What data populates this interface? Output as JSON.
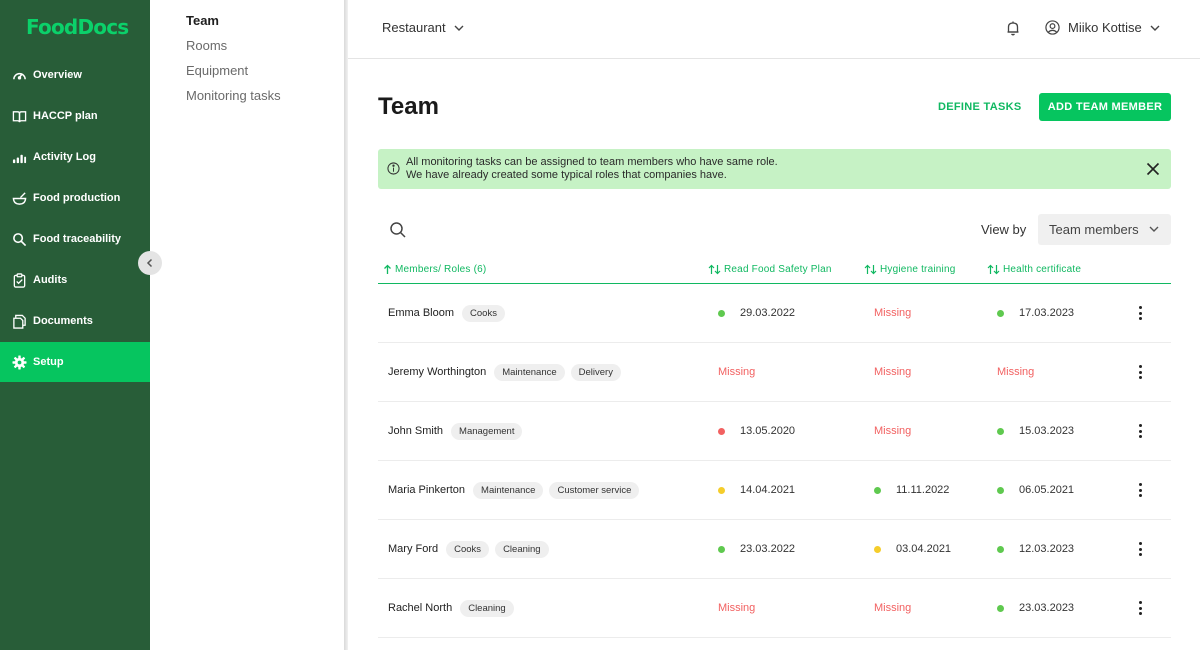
{
  "brand": {
    "logo_text": "FoodDocs"
  },
  "nav": {
    "items": [
      {
        "label": "Overview",
        "icon": "gauge-icon"
      },
      {
        "label": "HACCP plan",
        "icon": "book-icon"
      },
      {
        "label": "Activity Log",
        "icon": "bar-chart-icon"
      },
      {
        "label": "Food production",
        "icon": "bowl-icon"
      },
      {
        "label": "Food traceability",
        "icon": "search-icon"
      },
      {
        "label": "Audits",
        "icon": "clipboard-icon"
      },
      {
        "label": "Documents",
        "icon": "documents-icon"
      },
      {
        "label": "Setup",
        "icon": "gear-icon",
        "active": true
      }
    ]
  },
  "subnav": {
    "items": [
      {
        "label": "Team",
        "active": true
      },
      {
        "label": "Rooms"
      },
      {
        "label": "Equipment"
      },
      {
        "label": "Monitoring tasks"
      }
    ]
  },
  "topbar": {
    "location": "Restaurant",
    "user_name": "Miiko Kottise"
  },
  "page": {
    "title": "Team",
    "define_tasks_label": "DEFINE TASKS",
    "add_member_label": "ADD TEAM MEMBER"
  },
  "banner": {
    "line1": "All monitoring tasks can be assigned to team members who have same role.",
    "line2": "We have already created some typical roles that companies have."
  },
  "view_by": {
    "label": "View by",
    "selected": "Team members"
  },
  "table": {
    "headers": {
      "members": "Members/ Roles (6)",
      "food_safety": "Read Food Safety Plan",
      "hygiene": "Hygiene training",
      "health": "Health certificate"
    },
    "missing_label": "Missing",
    "status_colors": {
      "green": "#5fc94f",
      "red": "#f26161",
      "yellow": "#f5cd2b"
    },
    "rows": [
      {
        "name": "Emma Bloom",
        "roles": [
          "Cooks"
        ],
        "food_safety": {
          "status": "green",
          "date": "29.03.2022"
        },
        "hygiene": {
          "status": "missing",
          "date": "Missing"
        },
        "health": {
          "status": "green",
          "date": "17.03.2023"
        }
      },
      {
        "name": "Jeremy Worthington",
        "roles": [
          "Maintenance",
          "Delivery"
        ],
        "food_safety": {
          "status": "missing",
          "date": "Missing"
        },
        "hygiene": {
          "status": "missing",
          "date": "Missing"
        },
        "health": {
          "status": "missing",
          "date": "Missing"
        }
      },
      {
        "name": "John Smith",
        "roles": [
          "Management"
        ],
        "food_safety": {
          "status": "red",
          "date": "13.05.2020"
        },
        "hygiene": {
          "status": "missing",
          "date": "Missing"
        },
        "health": {
          "status": "green",
          "date": "15.03.2023"
        }
      },
      {
        "name": "Maria Pinkerton",
        "roles": [
          "Maintenance",
          "Customer service"
        ],
        "food_safety": {
          "status": "yellow",
          "date": "14.04.2021"
        },
        "hygiene": {
          "status": "green",
          "date": "11.11.2022"
        },
        "health": {
          "status": "green",
          "date": "06.05.2021"
        }
      },
      {
        "name": "Mary Ford",
        "roles": [
          "Cooks",
          "Cleaning"
        ],
        "food_safety": {
          "status": "green",
          "date": "23.03.2022"
        },
        "hygiene": {
          "status": "yellow",
          "date": "03.04.2021"
        },
        "health": {
          "status": "green",
          "date": "12.03.2023"
        }
      },
      {
        "name": "Rachel North",
        "roles": [
          "Cleaning"
        ],
        "food_safety": {
          "status": "missing",
          "date": "Missing"
        },
        "hygiene": {
          "status": "missing",
          "date": "Missing"
        },
        "health": {
          "status": "green",
          "date": "23.03.2023"
        }
      }
    ]
  }
}
